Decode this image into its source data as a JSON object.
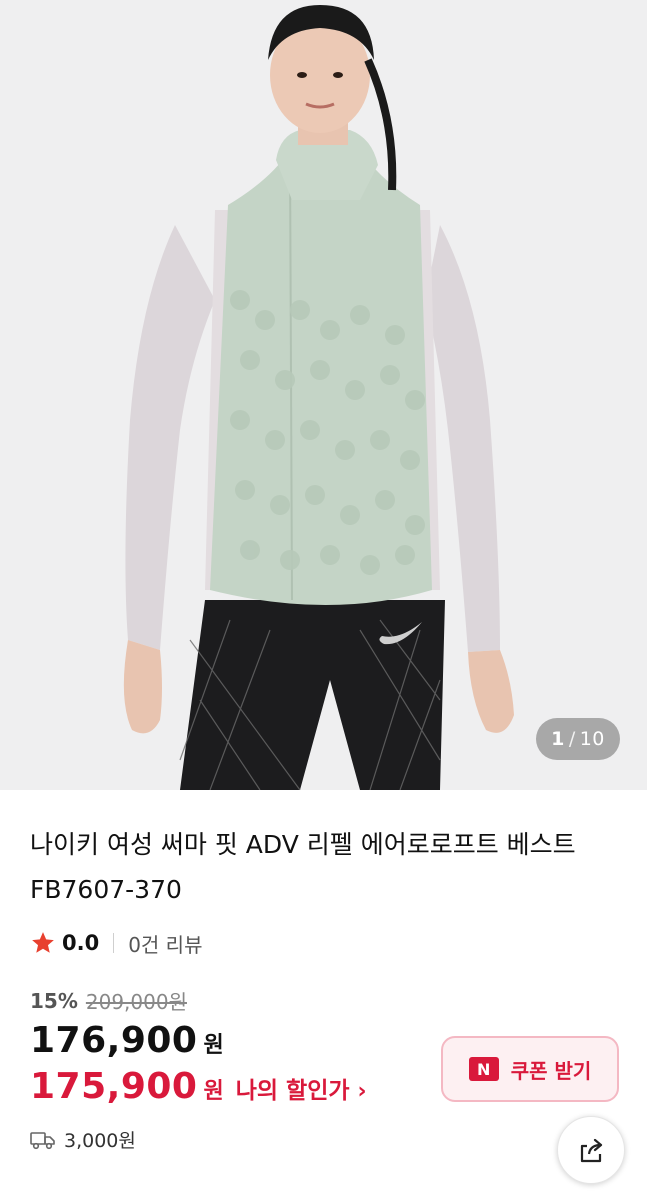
{
  "gallery": {
    "current": "1",
    "separator": "/",
    "total": "10",
    "image_alt": "product photo"
  },
  "product": {
    "title": "나이키 여성 써마 핏 ADV 리펠 에어로로프트 베스트 FB7607-370",
    "rating": "0.0",
    "review_count": "0건 리뷰",
    "discount_rate": "15%",
    "original_price": "209,000원",
    "price": "176,900",
    "price_unit": "원",
    "my_discount_price": "175,900",
    "my_discount_unit": "원",
    "my_discount_label": "나의 할인가",
    "my_discount_chevron": "›"
  },
  "coupon": {
    "badge": "N",
    "label": "쿠폰 받기"
  },
  "shipping": {
    "fee": "3,000원"
  },
  "icons": {
    "star": "star-icon",
    "truck": "truck-icon",
    "share": "share-icon",
    "coupon": "n-pay-badge"
  },
  "colors": {
    "accent": "#d9193b",
    "coupon_bg": "#fdf0f2",
    "star": "#e8402f"
  }
}
